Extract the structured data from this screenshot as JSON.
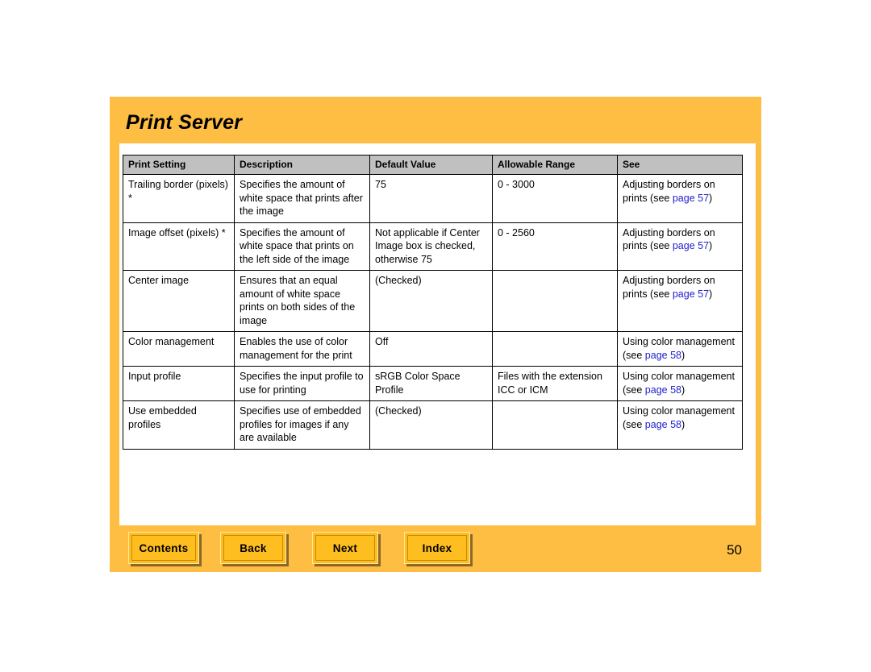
{
  "page": {
    "title": "Print Server",
    "number": "50",
    "accent_color": "#FEBE44",
    "button_color": "#FFBE20",
    "link_color": "#2222CC",
    "header_row_color": "#C0C0C0"
  },
  "table": {
    "headers": [
      "Print Setting",
      "Description",
      "Default Value",
      "Allowable Range",
      "See"
    ],
    "rows": [
      {
        "setting": "Trailing border (pixels) *",
        "description": "Specifies the amount of white space that prints after the image",
        "default_value": "75",
        "allowable_range": "0 - 3000",
        "see_prefix": "Adjusting borders on prints (see ",
        "see_link": "page 57",
        "see_suffix": ")"
      },
      {
        "setting": "Image offset (pixels) *",
        "description": "Specifies the amount of white space that prints on the left side of the image",
        "default_value": "Not applicable if Center Image box is checked, otherwise 75",
        "allowable_range": "0 - 2560",
        "see_prefix": "Adjusting borders on prints (see ",
        "see_link": "page 57",
        "see_suffix": ")"
      },
      {
        "setting": "Center image",
        "description": "Ensures that an equal amount of white space prints on both sides of the image",
        "default_value": "(Checked)",
        "allowable_range": "",
        "see_prefix": "Adjusting borders on prints (see ",
        "see_link": "page 57",
        "see_suffix": ")"
      },
      {
        "setting": "Color management",
        "description": "Enables the use of color management for the print",
        "default_value": "Off",
        "allowable_range": "",
        "see_prefix": "Using color management (see ",
        "see_link": "page 58",
        "see_suffix": ")"
      },
      {
        "setting": "Input profile",
        "description": "Specifies the input profile to use for printing",
        "default_value": "sRGB Color Space Profile",
        "allowable_range": "Files with the extension ICC or ICM",
        "see_prefix": "Using color management (see ",
        "see_link": "page 58",
        "see_suffix": ")"
      },
      {
        "setting": "Use embedded profiles",
        "description": "Specifies use of embedded profiles for images if any are available",
        "default_value": "(Checked)",
        "allowable_range": "",
        "see_prefix": "Using color management (see ",
        "see_link": "page 58",
        "see_suffix": ")"
      }
    ]
  },
  "nav": {
    "contents_label": "Contents",
    "back_label": "Back",
    "next_label": "Next",
    "index_label": "Index"
  }
}
